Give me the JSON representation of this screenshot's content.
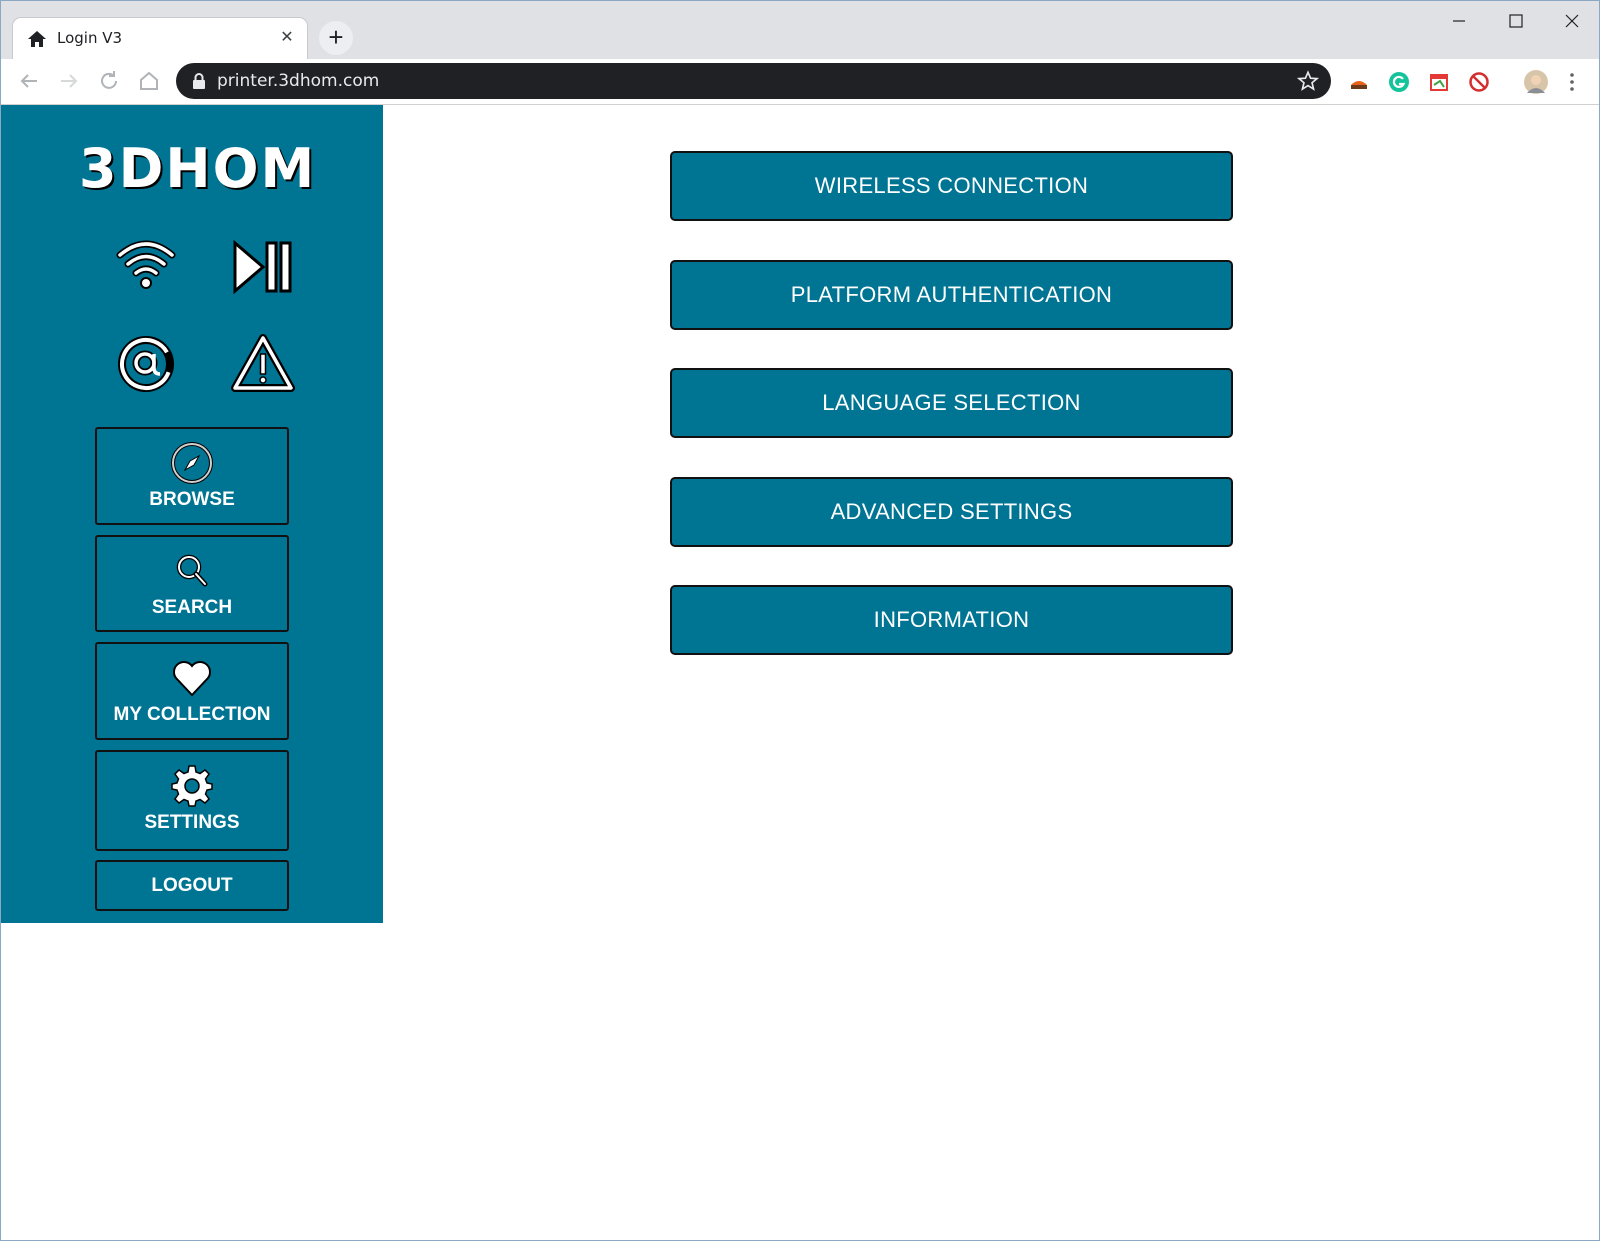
{
  "browser": {
    "tab_title": "Login V3",
    "tab_close": "✕",
    "new_tab": "+",
    "url": "printer.3dhom.com"
  },
  "sidebar": {
    "logo": "3DHOM",
    "nav": [
      {
        "label": "BROWSE",
        "icon": "compass-icon"
      },
      {
        "label": "SEARCH",
        "icon": "search-icon"
      },
      {
        "label": "MY COLLECTION",
        "icon": "heart-icon"
      },
      {
        "label": "SETTINGS",
        "icon": "gear-icon"
      }
    ],
    "logout_label": "LOGOUT",
    "status_icons": [
      "wifi-icon",
      "play-pause-icon",
      "at-icon",
      "warning-icon"
    ]
  },
  "settings_menu": [
    "WIRELESS CONNECTION",
    "PLATFORM AUTHENTICATION",
    "LANGUAGE SELECTION",
    "ADVANCED SETTINGS",
    "INFORMATION"
  ],
  "colors": {
    "accent": "#007493",
    "border": "#111111",
    "tabbar": "#dfe1e5",
    "omnibox": "#202124"
  }
}
